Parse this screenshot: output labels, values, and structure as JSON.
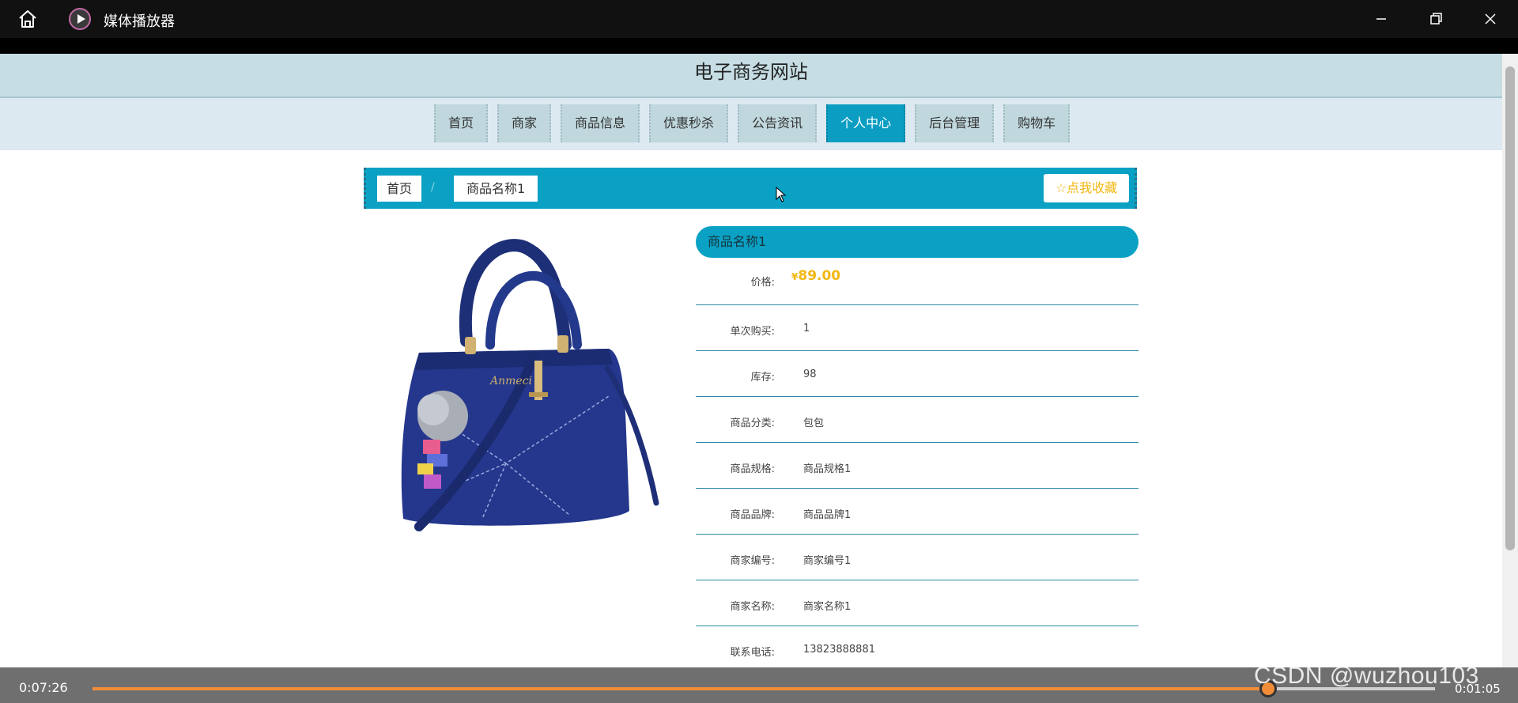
{
  "window": {
    "app_title": "媒体播放器"
  },
  "site": {
    "title": "电子商务网站"
  },
  "nav": {
    "items": [
      {
        "label": "首页"
      },
      {
        "label": "商家"
      },
      {
        "label": "商品信息"
      },
      {
        "label": "优惠秒杀"
      },
      {
        "label": "公告资讯"
      },
      {
        "label": "个人中心",
        "active": true
      },
      {
        "label": "后台管理"
      },
      {
        "label": "购物车"
      }
    ]
  },
  "breadcrumb": {
    "home": "首页",
    "separator": "/",
    "current": "商品名称1"
  },
  "favorite": {
    "icon": "star-outline-icon",
    "label": "点我收藏"
  },
  "product": {
    "name": "商品名称1",
    "image_alt": "navy blue handbag",
    "price_symbol": "¥",
    "price_value": "89.00",
    "price_label": "价格:",
    "fields": [
      {
        "label": "单次购买:",
        "value": "1"
      },
      {
        "label": "库存:",
        "value": "98"
      },
      {
        "label": "商品分类:",
        "value": "包包"
      },
      {
        "label": "商品规格:",
        "value": "商品规格1"
      },
      {
        "label": "商品品牌:",
        "value": "商品品牌1"
      },
      {
        "label": "商家编号:",
        "value": "商家编号1"
      },
      {
        "label": "商家名称:",
        "value": "商家名称1"
      },
      {
        "label": "联系电话:",
        "value": "13823888881"
      }
    ]
  },
  "player": {
    "current_time": "0:07:26",
    "remaining_time": "0:01:05",
    "progress": 0.8755
  },
  "watermark": "CSDN @wuzhou103",
  "colors": {
    "accent": "#0aa1c4",
    "price": "#f3b713",
    "progress": "#f18d38"
  }
}
